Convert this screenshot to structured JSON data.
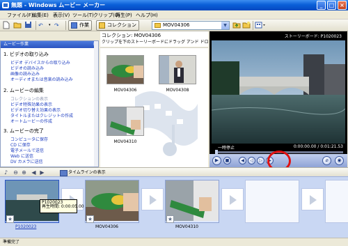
{
  "window": {
    "title": "無題 - Windows ムービー メーカー",
    "buttons": [
      "_",
      "□",
      "×"
    ]
  },
  "menu": [
    "ファイル(F)",
    "編集(E)",
    "表示(V)",
    "ツール(T)",
    "クリップ(C)",
    "再生(P)",
    "ヘルプ(H)"
  ],
  "toolbar": {
    "tasks_label": "作業",
    "collections_label": "コレクション",
    "collection_value": "MOV04306",
    "undo_glyph": "↶",
    "redo_glyph": "↷"
  },
  "tasks_pane": {
    "header": "ムービー作業",
    "close": "×",
    "sections": [
      {
        "title": "1. ビデオの取り込み",
        "links": [
          {
            "label": "ビデオ デバイスからの取り込み",
            "dim": false
          },
          {
            "label": "ビデオの読み込み",
            "dim": false
          },
          {
            "label": "画像の読み込み",
            "dim": false
          },
          {
            "label": "オーディオまたは音楽の読み込み",
            "dim": false
          }
        ]
      },
      {
        "title": "2. ムービーの編集",
        "links": [
          {
            "label": "コレクションの表示",
            "dim": true
          },
          {
            "label": "ビデオ特殊効果の表示",
            "dim": false
          },
          {
            "label": "ビデオ切り替え効果の表示",
            "dim": false
          },
          {
            "label": "タイトルまたはクレジットの作成",
            "dim": false
          },
          {
            "label": "オートムービーの作成",
            "dim": false
          }
        ]
      },
      {
        "title": "3. ムービーの完了",
        "links": [
          {
            "label": "コンピュータに保存",
            "dim": false
          },
          {
            "label": "CD に保存",
            "dim": false
          },
          {
            "label": "電子メールで送信",
            "dim": false
          },
          {
            "label": "Web に送信",
            "dim": false
          },
          {
            "label": "DV カメラに送信",
            "dim": false
          }
        ]
      }
    ]
  },
  "collection": {
    "title": "コレクション: MOV04306",
    "hint": "クリップを下のストーリーボードにドラッグ アンド ドロップしてください。",
    "clips": [
      {
        "label": "MOV04306"
      },
      {
        "label": "MOV04308"
      },
      {
        "label": "MOV04310"
      }
    ]
  },
  "player": {
    "title": "ストーリーボード: P1020023",
    "state": "一時停止",
    "timecode": "0:00:00.00 / 0:01:21.53",
    "seek_position": 0.0
  },
  "storyboard_toolbar": {
    "show_timeline": "タイムラインの表示",
    "buttons": [
      "◀",
      "▶",
      "⊖",
      "⊕",
      "◀◀",
      "▶"
    ]
  },
  "storyboard": {
    "clips": [
      {
        "label": "P1020023",
        "selected": true
      },
      {
        "label": "MOV04306",
        "selected": false
      },
      {
        "label": "MOV04310",
        "selected": false
      }
    ],
    "tooltip": {
      "name": "P1020023",
      "duration": "再生時間: 0:00:05.00"
    }
  },
  "status": "準備完了"
}
